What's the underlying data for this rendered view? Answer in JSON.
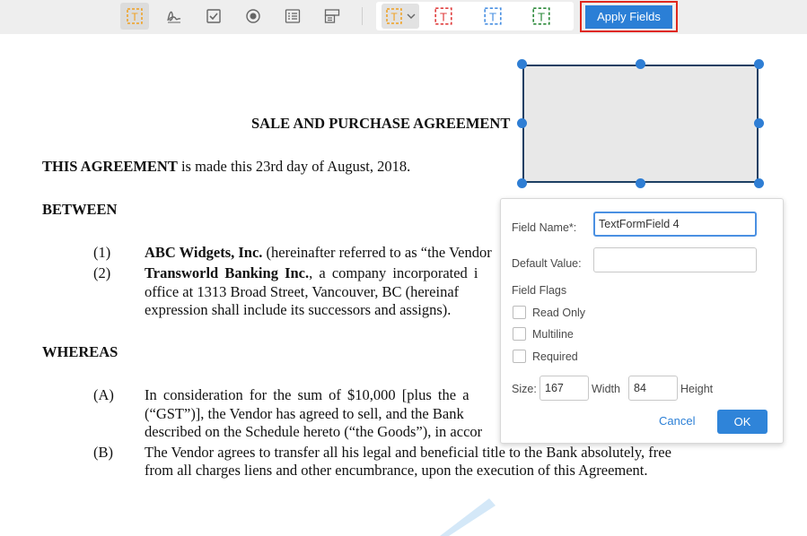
{
  "toolbar": {
    "tools": [
      {
        "name": "text-field-tool",
        "icon": "text-field-icon",
        "active": true
      },
      {
        "name": "signature-tool",
        "icon": "signature-icon",
        "active": false
      },
      {
        "name": "checkbox-tool",
        "icon": "checkbox-icon",
        "active": false
      },
      {
        "name": "radio-tool",
        "icon": "radio-icon",
        "active": false
      },
      {
        "name": "listbox-tool",
        "icon": "listbox-icon",
        "active": false
      },
      {
        "name": "combobox-tool",
        "icon": "combobox-icon",
        "active": false
      }
    ],
    "field_glyph": "T",
    "styles": [
      "#f0a020",
      "#e04040",
      "#4a90e2",
      "#2e8b3c"
    ],
    "apply_label": "Apply Fields",
    "apply_color": "#2b7fd6",
    "highlight_color": "#e0281d"
  },
  "document": {
    "title": "SALE AND PURCHASE AGREEMENT",
    "intro_bold": "THIS AGREEMENT",
    "intro_rest": " is made this 23rd day of August, 2018.",
    "between": "BETWEEN",
    "parties": [
      {
        "num": "(1)",
        "bold": "ABC Widgets, Inc.",
        "rest": " (hereinafter referred to as “the Vendor"
      },
      {
        "num": "(2)",
        "bold": "Transworld Banking Inc.",
        "rest": ", a company incorporated i"
      }
    ],
    "party2_line2": "office at 1313 Broad Street, Vancouver, BC (hereinaf",
    "party2_line3": "expression shall include its successors and assigns).",
    "whereas": "WHEREAS",
    "clauses": [
      {
        "num": "(A)",
        "lines": [
          "In consideration for the sum of $10,000 [plus the a",
          "(“GST”)], the Vendor has agreed to sell, and the Bank",
          "described on the Schedule hereto (“the Goods”), in accor"
        ]
      },
      {
        "num": "(B)",
        "lines": [
          "The Vendor agrees to transfer all his legal and beneficial title to the Bank absolutely, free",
          "from all charges liens and other encumbrance, upon the execution of this Agreement."
        ]
      }
    ]
  },
  "panel": {
    "field_name_label": "Field Name*:",
    "field_name_value": "TextFormField 4",
    "default_value_label": "Default Value:",
    "default_value": "",
    "flags_heading": "Field Flags",
    "flags": [
      {
        "label": "Read Only",
        "checked": false
      },
      {
        "label": "Multiline",
        "checked": false
      },
      {
        "label": "Required",
        "checked": false
      }
    ],
    "size_label": "Size:",
    "width_value": "167",
    "width_label": "Width",
    "height_value": "84",
    "height_label": "Height",
    "cancel_label": "Cancel",
    "ok_label": "OK"
  }
}
